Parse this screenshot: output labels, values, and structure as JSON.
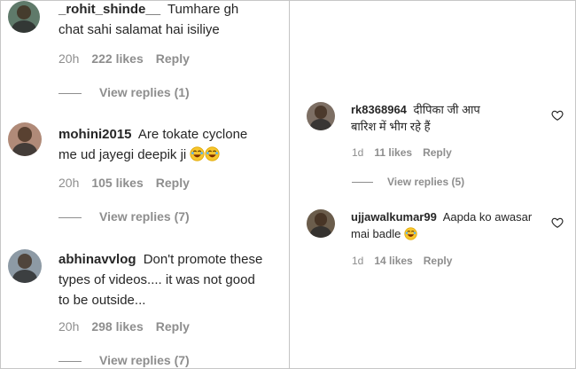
{
  "left": {
    "comments": [
      {
        "username": "_rohit_shinde__",
        "text_line1": "Tumhare gh",
        "text_line2": "chat sahi salamat hai isiliye",
        "time": "20h",
        "likes": "222 likes",
        "reply": "Reply",
        "view_replies": "View replies (1)"
      },
      {
        "username": "mohini2015",
        "text_line1": "Are tokate cyclone",
        "text_line2": "me ud jayegi deepik ji",
        "time": "20h",
        "likes": "105 likes",
        "reply": "Reply",
        "view_replies": "View replies (7)"
      },
      {
        "username": "abhinavvlog",
        "text_line1": "Don't promote these",
        "text_line2": "types of videos.... it was not good",
        "text_line3": "to be outside...",
        "time": "20h",
        "likes": "298 likes",
        "reply": "Reply",
        "view_replies": "View replies (7)"
      }
    ]
  },
  "right": {
    "comments": [
      {
        "username": "rk8368964",
        "text_line1": "दीपिका जी आप",
        "text_line2": "बारिश में भीग रहे हैं",
        "time": "1d",
        "likes": "11 likes",
        "reply": "Reply",
        "view_replies": "View replies (5)",
        "icon": "heart-outline-icon"
      },
      {
        "username": "ujjawalkumar99",
        "text_line1": "Aapda ko awasar",
        "text_line2": "mai badle",
        "time": "1d",
        "likes": "14 likes",
        "reply": "Reply",
        "icon": "heart-outline-icon"
      }
    ]
  },
  "colors": {
    "text": "#262626",
    "meta": "#8e8e8e",
    "divider": "#c4c4c4"
  }
}
